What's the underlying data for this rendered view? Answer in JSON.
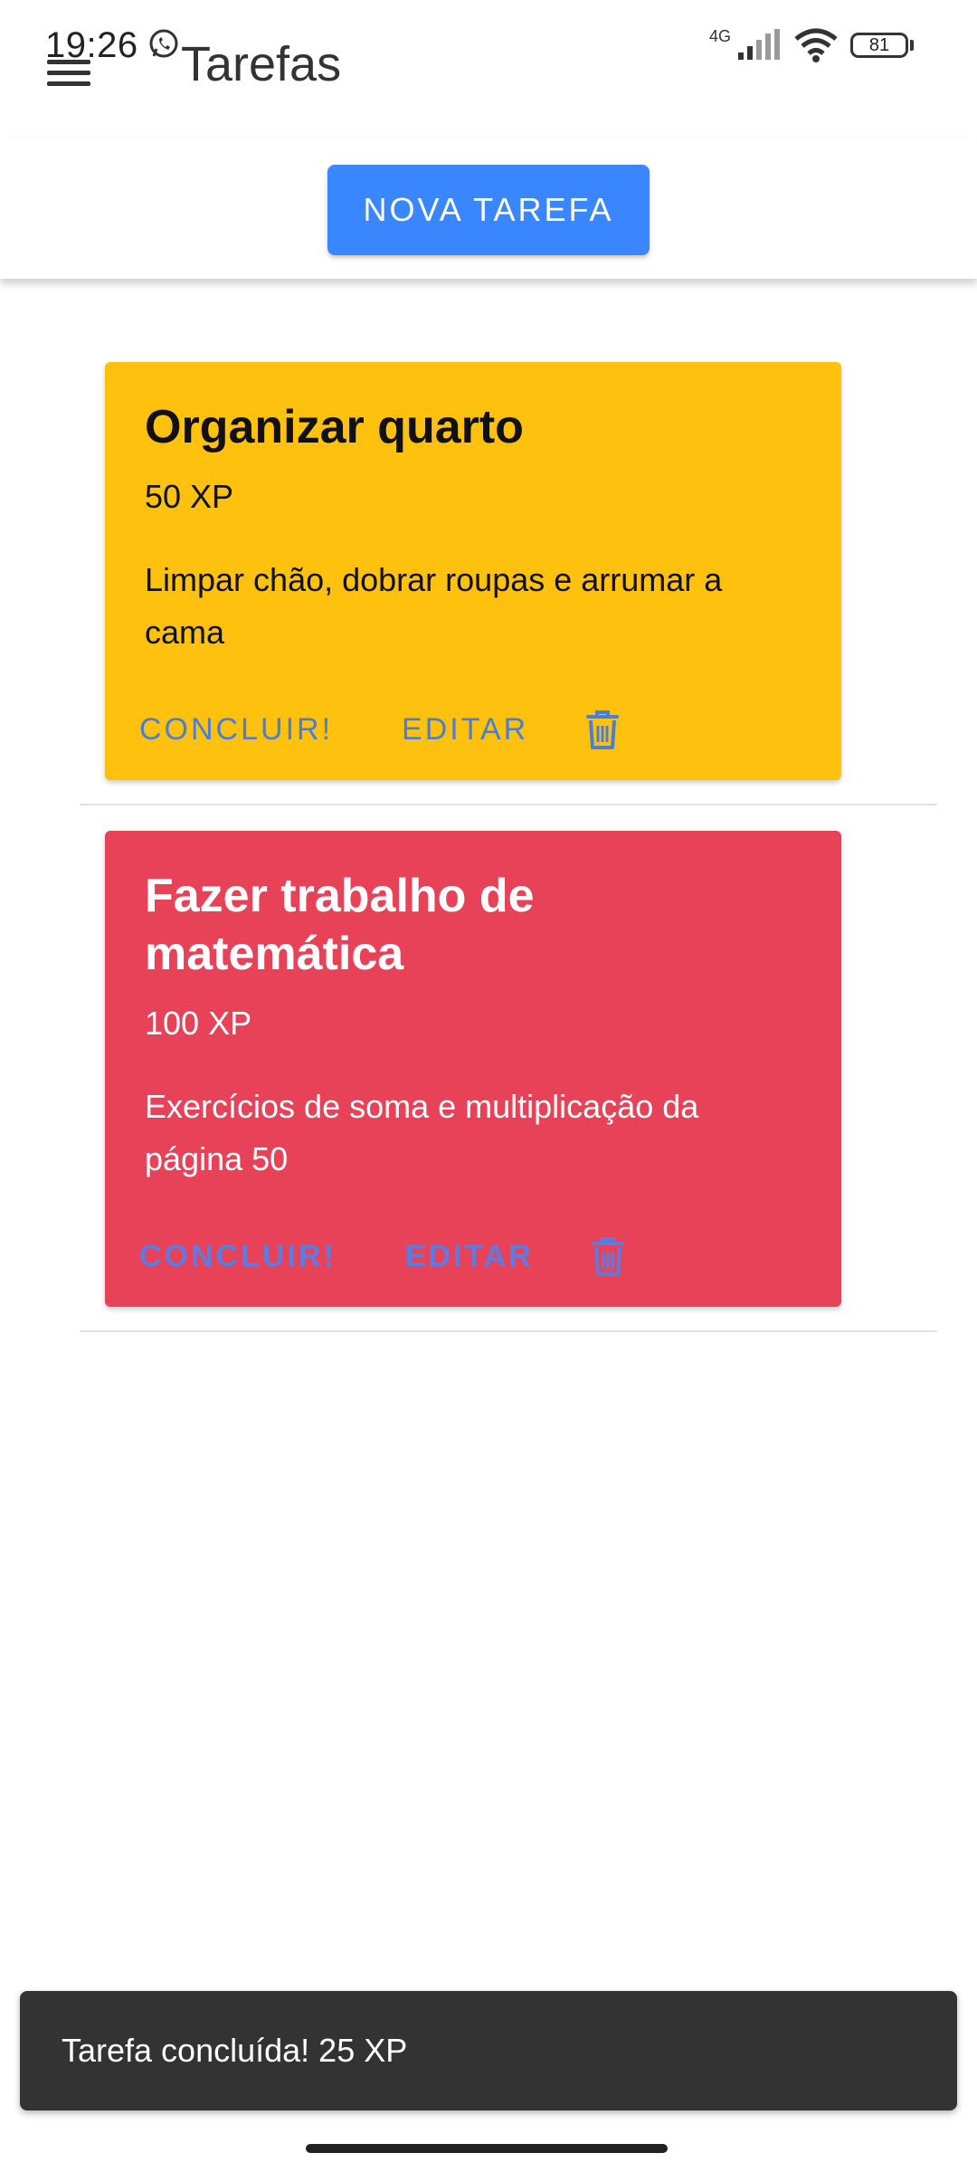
{
  "status_bar": {
    "time": "19:26",
    "network_label": "4G",
    "battery": "81"
  },
  "app_bar": {
    "title": "Tarefas"
  },
  "toolbar": {
    "new_task_label": "NOVA TAREFA"
  },
  "tasks": [
    {
      "title": "Organizar quarto",
      "xp": "50 XP",
      "description": "Limpar chão, dobrar roupas e arrumar a cama",
      "complete_label": "CONCLUIR!",
      "edit_label": "EDITAR",
      "color": "#fdc10e"
    },
    {
      "title": "Fazer trabalho de matemática",
      "xp": "100 XP",
      "description": "Exercícios de soma e multiplicação da página 50",
      "complete_label": "CONCLUIR!",
      "edit_label": "EDITAR",
      "color": "#e84259"
    }
  ],
  "snackbar": {
    "message": "Tarefa concluída! 25 XP"
  },
  "icons": {
    "menu": "menu-icon",
    "whatsapp": "whatsapp-icon",
    "signal": "signal-icon",
    "wifi": "wifi-icon",
    "battery": "battery-icon",
    "delete": "trash-icon"
  },
  "colors": {
    "accent": "#3a86ff",
    "action_text": "#4a7fd8",
    "snackbar": "#333333"
  }
}
